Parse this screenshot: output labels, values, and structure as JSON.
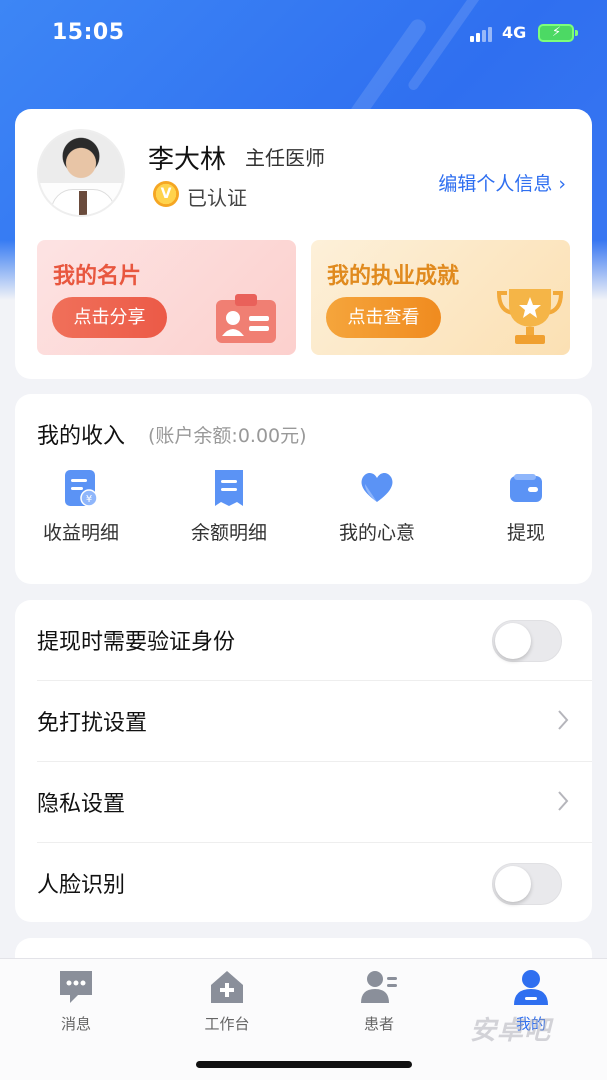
{
  "status_bar": {
    "time": "15:05",
    "network": "4G"
  },
  "profile": {
    "name": "李大林",
    "title": "主任医师",
    "verified_label": "已认证",
    "verified_badge": "V",
    "edit_link": "编辑个人信息 ›"
  },
  "promos": [
    {
      "title": "我的名片",
      "button": "点击分享",
      "color": "#ec5a47",
      "icon": "id-card-icon"
    },
    {
      "title": "我的执业成就",
      "button": "点击查看",
      "color": "#f08b1f",
      "icon": "trophy-icon"
    }
  ],
  "income": {
    "title": "我的收入",
    "balance_text": "(账户余额:0.00元)",
    "items": [
      {
        "label": "收益明细",
        "icon": "income-detail-icon"
      },
      {
        "label": "余额明细",
        "icon": "balance-detail-icon"
      },
      {
        "label": "我的心意",
        "icon": "heart-icon"
      },
      {
        "label": "提现",
        "icon": "wallet-icon"
      }
    ]
  },
  "settings": [
    {
      "label": "提现时需要验证身份",
      "control": "toggle",
      "on": false
    },
    {
      "label": "免打扰设置",
      "control": "chevron"
    },
    {
      "label": "隐私设置",
      "control": "chevron"
    },
    {
      "label": "人脸识别",
      "control": "toggle",
      "on": false
    }
  ],
  "tabs": [
    {
      "label": "消息",
      "icon": "message-icon",
      "active": false
    },
    {
      "label": "工作台",
      "icon": "workbench-icon",
      "active": false
    },
    {
      "label": "患者",
      "icon": "patient-icon",
      "active": false
    },
    {
      "label": "我的",
      "icon": "profile-icon",
      "active": true
    }
  ],
  "watermark": "安卓吧",
  "colors": {
    "accent": "#2f6ff0",
    "toggle_off": "#e9e9ec",
    "tab_inactive": "#8a8f9a"
  }
}
